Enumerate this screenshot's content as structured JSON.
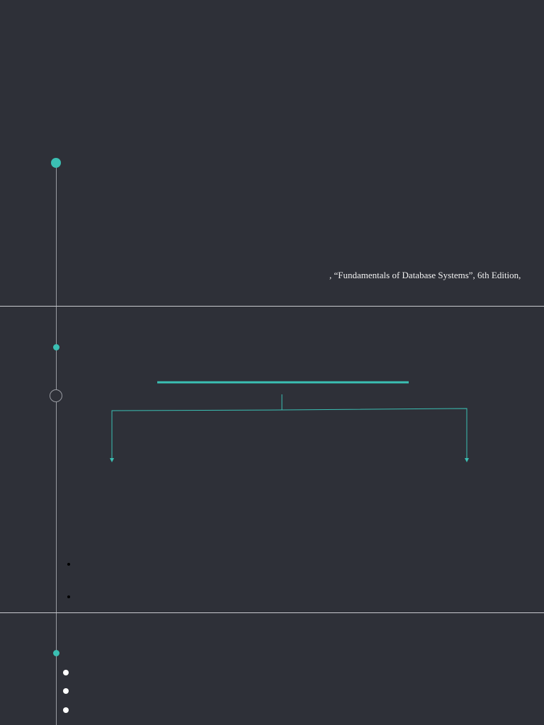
{
  "slide1": {
    "citation": ", “Fundamentals of Database Systems”, 6th Edition,"
  },
  "colors": {
    "accent": "#3bbfb3",
    "background": "#2e3038"
  }
}
